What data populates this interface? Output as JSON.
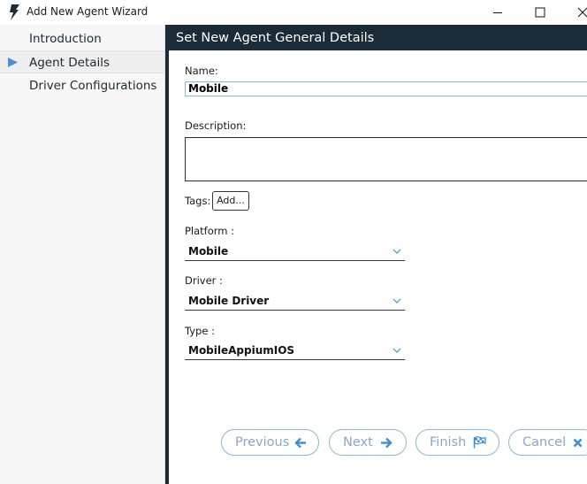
{
  "window": {
    "title": "Add New Agent Wizard"
  },
  "sidebar": {
    "items": [
      {
        "label": "Introduction",
        "active": false
      },
      {
        "label": "Agent Details",
        "active": true
      },
      {
        "label": "Driver Configurations",
        "active": false
      }
    ]
  },
  "main": {
    "header": "Set New Agent General Details",
    "name_label": "Name:",
    "name_value": "Mobile",
    "description_label": "Description:",
    "description_value": "",
    "tags_label": "Tags:",
    "tags_add_label": "Add...",
    "platform_label": "Platform :",
    "platform_value": "Mobile",
    "driver_label": "Driver :",
    "driver_value": "Mobile Driver",
    "type_label": "Type :",
    "type_value": "MobileAppiumIOS"
  },
  "footer": {
    "previous_label": "Previous",
    "next_label": "Next",
    "finish_label": "Finish",
    "cancel_label": "Cancel"
  },
  "colors": {
    "header_bg": "#1b2b38",
    "button_text": "#8aa7c8",
    "button_icon": "#3a8fd6",
    "button_border": "#8cb5da",
    "nav_arrow": "#4a90d9"
  },
  "icons": {
    "app": "lightning-bolt-icon",
    "previous": "arrow-left-icon",
    "next": "arrow-right-icon",
    "finish": "checkered-flag-icon",
    "cancel": "close-x-icon"
  }
}
